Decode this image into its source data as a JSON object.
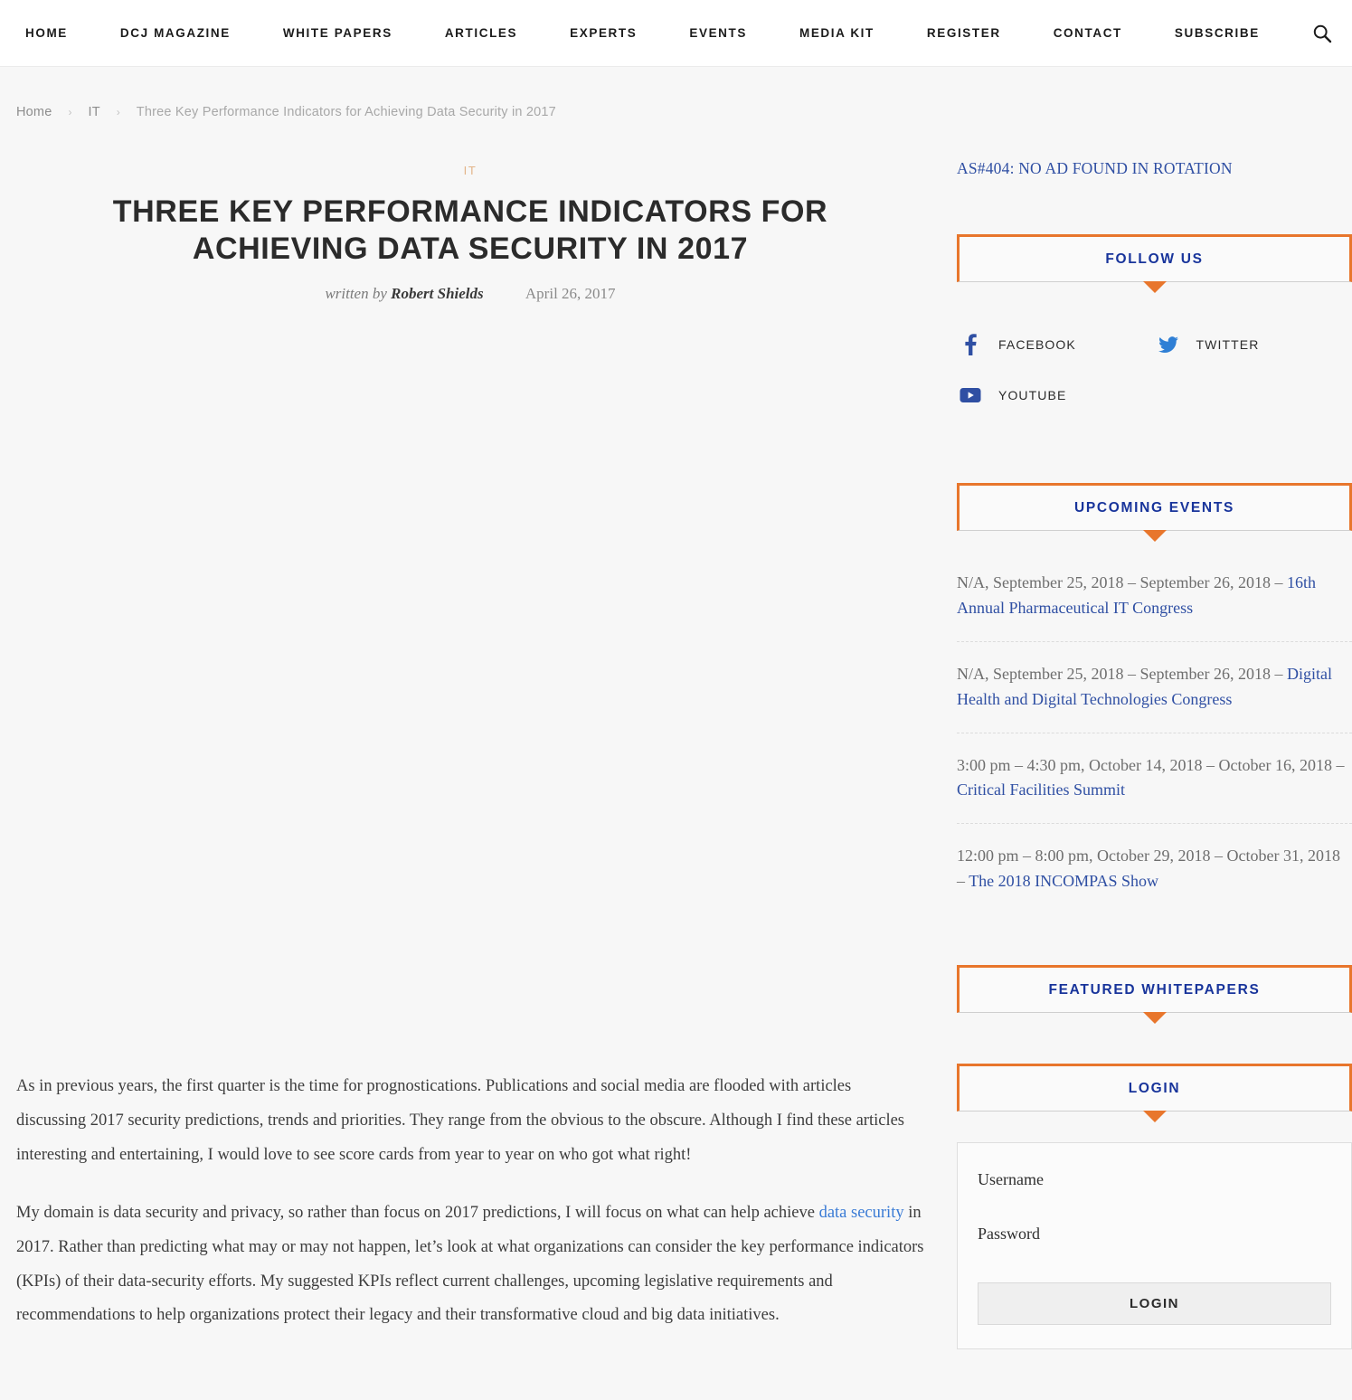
{
  "nav": {
    "items": [
      {
        "label": "HOME",
        "name": "nav-item-home"
      },
      {
        "label": "DCJ MAGAZINE",
        "name": "nav-item-dcj-magazine"
      },
      {
        "label": "WHITE PAPERS",
        "name": "nav-item-white-papers"
      },
      {
        "label": "ARTICLES",
        "name": "nav-item-articles"
      },
      {
        "label": "EXPERTS",
        "name": "nav-item-experts"
      },
      {
        "label": "EVENTS",
        "name": "nav-item-events"
      },
      {
        "label": "MEDIA KIT",
        "name": "nav-item-media-kit"
      },
      {
        "label": "REGISTER",
        "name": "nav-item-register"
      },
      {
        "label": "CONTACT",
        "name": "nav-item-contact"
      },
      {
        "label": "SUBSCRIBE",
        "name": "nav-item-subscribe"
      }
    ],
    "search_icon": "search-icon"
  },
  "breadcrumb": {
    "home": "Home",
    "section": "IT",
    "current": "Three Key Performance Indicators for Achieving Data Security in 2017",
    "separator": "›"
  },
  "article": {
    "category": "IT",
    "title": "THREE KEY PERFORMANCE INDICATORS FOR ACHIEVING DATA SECURITY IN 2017",
    "written_by": "written by",
    "author": "Robert Shields",
    "date": "April 26, 2017",
    "paragraph_1": "As in previous years, the first quarter is the time for prognostications. Publications and social media are flooded with articles discussing 2017 security predictions, trends and priorities. They range from the obvious to the obscure. Although I find these articles interesting and entertaining, I would love to see score cards from year to year on who got what right!",
    "paragraph_2_part1": "My domain is data security and privacy, so rather than focus on 2017 predictions, I will focus on what can help achieve ",
    "paragraph_2_link": "data security",
    "paragraph_2_part2": " in 2017. Rather than predicting what may or may not happen, let’s look at what organizations can consider the key performance indicators (KPIs) of their data-security efforts. My suggested KPIs reflect current challenges, upcoming legislative requirements and recommendations to help organizations protect their legacy and their transformative cloud and big data initiatives."
  },
  "sidebar": {
    "ad_notice": "AS#404: NO AD FOUND IN ROTATION",
    "follow_us": {
      "title": "FOLLOW US",
      "items": [
        {
          "label": "FACEBOOK",
          "icon": "facebook-icon",
          "color": "#2f4fa3"
        },
        {
          "label": "TWITTER",
          "icon": "twitter-icon",
          "color": "#2f7fd5"
        },
        {
          "label": "YOUTUBE",
          "icon": "youtube-icon",
          "color": "#2f4fa3"
        }
      ]
    },
    "upcoming_events": {
      "title": "UPCOMING EVENTS",
      "items": [
        {
          "date": "N/A, September 25, 2018 – September 26, 2018 – ",
          "link": "16th Annual Pharmaceutical IT Congress"
        },
        {
          "date": "N/A, September 25, 2018 – September 26, 2018 – ",
          "link": "Digital Health and Digital Technologies Congress"
        },
        {
          "date": "3:00 pm – 4:30 pm, October 14, 2018 – October 16, 2018 – ",
          "link": "Critical Facilities Summit"
        },
        {
          "date": "12:00 pm – 8:00 pm, October 29, 2018 – October 31, 2018 – ",
          "link": "The 2018 INCOMPAS Show"
        }
      ]
    },
    "featured_whitepapers": {
      "title": "FEATURED WHITEPAPERS"
    },
    "login": {
      "title": "LOGIN",
      "username_placeholder": "Username",
      "username_value": "",
      "password_placeholder": "Password",
      "password_value": "",
      "submit_label": "LOGIN"
    }
  },
  "colors": {
    "accent_orange": "#e8762c",
    "link_blue": "#2f4fa3",
    "body_link_blue": "#3a7bd5",
    "category_tan": "#e3b488",
    "page_bg": "#f7f7f7"
  }
}
